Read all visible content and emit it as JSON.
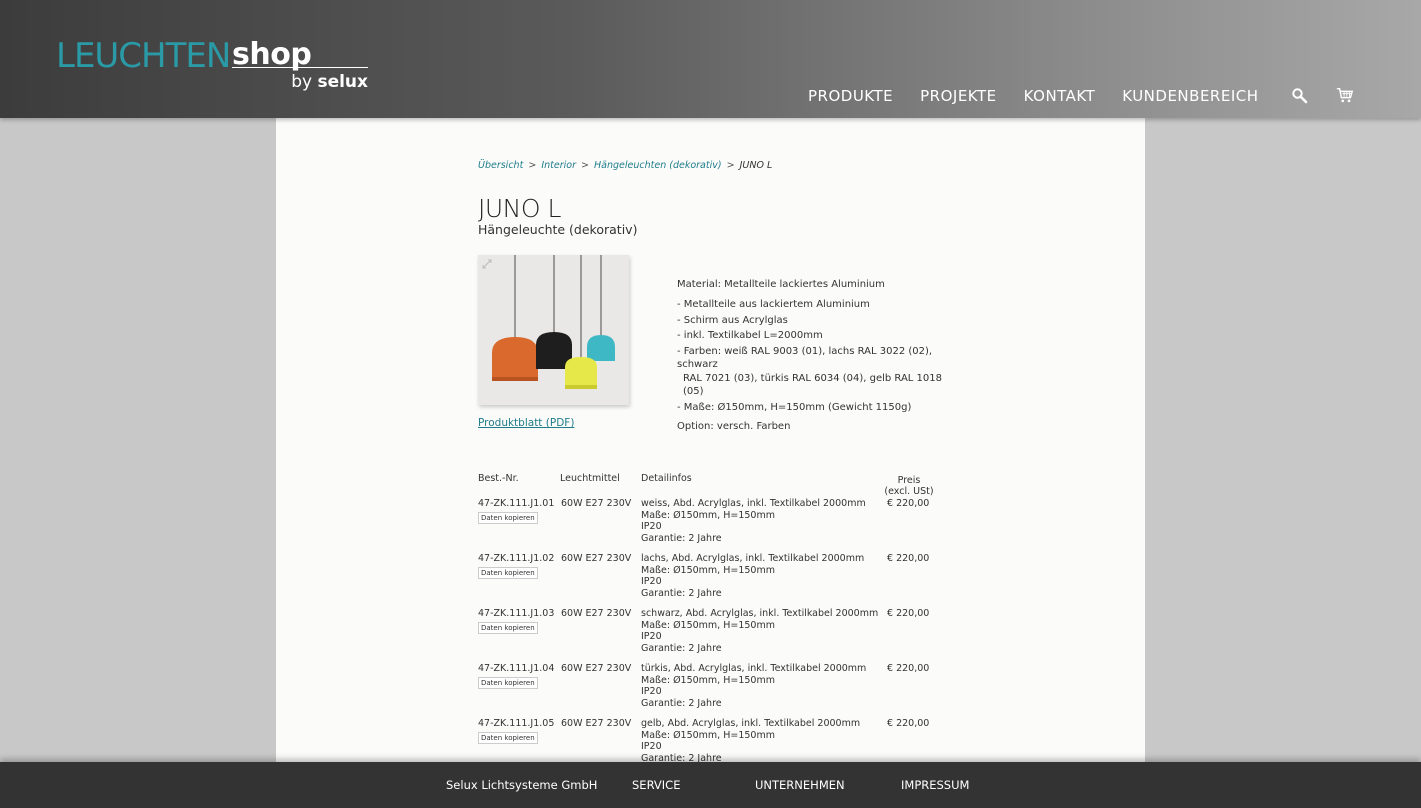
{
  "header": {
    "logo": {
      "part1": "LEUCHTEN",
      "part2": "shop",
      "by_prefix": "by ",
      "by_brand": "selux"
    },
    "nav": [
      "PRODUKTE",
      "PROJEKTE",
      "KONTAKT",
      "KUNDENBEREICH"
    ],
    "icons": [
      "search-icon",
      "cart-icon"
    ]
  },
  "breadcrumb": {
    "items": [
      "Übersicht",
      "Interior",
      "Hängeleuchten (dekorativ)"
    ],
    "current": "JUNO L",
    "separator": ">"
  },
  "product": {
    "title": "JUNO L",
    "subtitle": "Hängeleuchte (dekorativ)",
    "pdf_link": "Produktblatt (PDF)",
    "material": "Material: Metallteile lackiertes Aluminium",
    "features": [
      "- Metallteile aus lackiertem Aluminium",
      "- Schirm aus Acrylglas",
      "- inkl. Textilkabel L=2000mm",
      "- Farben: weiß RAL 9003 (01), lachs RAL 3022 (02), schwarz",
      "RAL 7021 (03), türkis RAL 6034 (04), gelb RAL 1018 (05)",
      "- Maße: Ø150mm, H=150mm (Gewicht 1150g)"
    ],
    "option": "Option: versch. Farben"
  },
  "table": {
    "headers": {
      "nr": "Best.-Nr.",
      "leuchtmittel": "Leuchtmittel",
      "details": "Detailinfos",
      "preis_line1": "Preis",
      "preis_line2": "(excl. USt)"
    },
    "copy_label": "Daten kopieren",
    "rows": [
      {
        "nr": "47-ZK.111.J1.01",
        "leuchtmittel": "60W E27  230V",
        "d1": "weiss, Abd. Acrylglas, inkl. Textilkabel 2000mm",
        "d2": "Maße: Ø150mm, H=150mm",
        "d3": "IP20",
        "d4": "Garantie: 2 Jahre",
        "preis": "€ 220,00"
      },
      {
        "nr": "47-ZK.111.J1.02",
        "leuchtmittel": "60W E27  230V",
        "d1": "lachs, Abd. Acrylglas, inkl. Textilkabel 2000mm",
        "d2": "Maße: Ø150mm, H=150mm",
        "d3": "IP20",
        "d4": "Garantie: 2 Jahre",
        "preis": "€ 220,00"
      },
      {
        "nr": "47-ZK.111.J1.03",
        "leuchtmittel": "60W E27  230V",
        "d1": "schwarz, Abd. Acrylglas, inkl. Textilkabel 2000mm",
        "d2": "Maße: Ø150mm, H=150mm",
        "d3": "IP20",
        "d4": "Garantie: 2 Jahre",
        "preis": "€ 220,00"
      },
      {
        "nr": "47-ZK.111.J1.04",
        "leuchtmittel": "60W E27  230V",
        "d1": "türkis, Abd. Acrylglas, inkl. Textilkabel 2000mm",
        "d2": "Maße: Ø150mm, H=150mm",
        "d3": "IP20",
        "d4": "Garantie: 2 Jahre",
        "preis": "€ 220,00"
      },
      {
        "nr": "47-ZK.111.J1.05",
        "leuchtmittel": "60W E27  230V",
        "d1": "gelb, Abd. Acrylglas, inkl. Textilkabel 2000mm",
        "d2": "Maße: Ø150mm, H=150mm",
        "d3": "IP20",
        "d4": "Garantie: 2 Jahre",
        "preis": "€ 220,00"
      }
    ]
  },
  "footer": {
    "company": "Selux Lichtsysteme GmbH",
    "links": [
      "SERVICE",
      "UNTERNEHMEN",
      "IMPRESSUM"
    ]
  },
  "colors": {
    "accent": "#2a9aa6",
    "link": "#1f7d8a",
    "lamp_orange": "#d9692c",
    "lamp_black": "#1e1e1e",
    "lamp_teal": "#3db8c4",
    "lamp_yellow": "#e6e84a"
  }
}
